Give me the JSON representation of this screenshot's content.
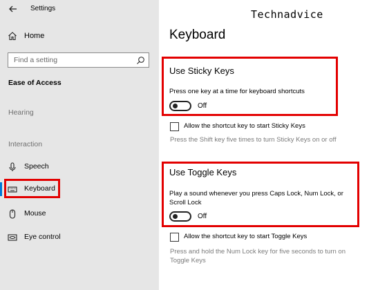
{
  "window": {
    "title": "Settings"
  },
  "sidebar": {
    "home_label": "Home",
    "search_placeholder": "Find a setting",
    "section_heading": "Ease of Access",
    "group_hearing": "Hearing",
    "group_interaction": "Interaction",
    "items": [
      {
        "label": "Speech",
        "icon": "microphone-icon"
      },
      {
        "label": "Keyboard",
        "icon": "keyboard-icon",
        "active": true
      },
      {
        "label": "Mouse",
        "icon": "mouse-icon"
      },
      {
        "label": "Eye control",
        "icon": "eye-control-icon"
      }
    ]
  },
  "watermark": "Technadvice",
  "main": {
    "title": "Keyboard",
    "sticky_keys": {
      "heading": "Use Sticky Keys",
      "description": "Press one key at a time for keyboard shortcuts",
      "toggle_state": "Off",
      "shortcut_checkbox_label": "Allow the shortcut key to start Sticky Keys",
      "shortcut_hint": "Press the Shift key five times to turn Sticky Keys on or off"
    },
    "toggle_keys": {
      "heading": "Use Toggle Keys",
      "description_line1": "Play a sound whenever you press Caps Lock, Num Lock, or",
      "description_line2": "Scroll Lock",
      "toggle_state": "Off",
      "shortcut_checkbox_label": "Allow the shortcut key to start Toggle Keys",
      "shortcut_hint_line1": "Press and hold the Num Lock key for five seconds to turn on",
      "shortcut_hint_line2": "Toggle Keys"
    }
  },
  "colors": {
    "highlight": "#e30000",
    "accent": "#0078d7",
    "sidebar_bg": "#e6e6e6"
  }
}
